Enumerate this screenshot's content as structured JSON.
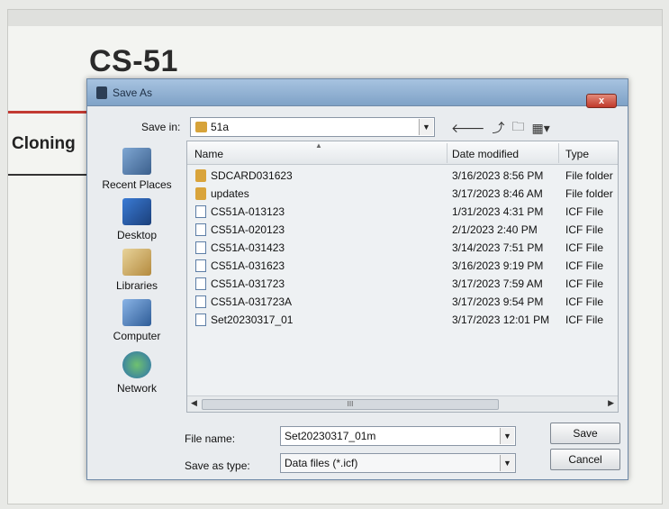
{
  "background": {
    "app_title": "CS-51",
    "side_label": "Cloning"
  },
  "dialog": {
    "title": "Save As",
    "close_label": "x",
    "save_in_label": "Save in:",
    "save_in_value": "51a",
    "places": [
      {
        "label": "Recent Places",
        "icon": "recent-places-icon"
      },
      {
        "label": "Desktop",
        "icon": "desktop-icon"
      },
      {
        "label": "Libraries",
        "icon": "libraries-icon"
      },
      {
        "label": "Computer",
        "icon": "computer-icon"
      },
      {
        "label": "Network",
        "icon": "network-icon"
      }
    ],
    "columns": {
      "name": "Name",
      "date": "Date modified",
      "type": "Type"
    },
    "files": [
      {
        "name": "SDCARD031623",
        "date": "3/16/2023 8:56 PM",
        "type": "File folder",
        "kind": "folder"
      },
      {
        "name": "updates",
        "date": "3/17/2023 8:46 AM",
        "type": "File folder",
        "kind": "folder"
      },
      {
        "name": "CS51A-013123",
        "date": "1/31/2023 4:31 PM",
        "type": "ICF File",
        "kind": "file"
      },
      {
        "name": "CS51A-020123",
        "date": "2/1/2023 2:40 PM",
        "type": "ICF File",
        "kind": "file"
      },
      {
        "name": "CS51A-031423",
        "date": "3/14/2023 7:51 PM",
        "type": "ICF File",
        "kind": "file"
      },
      {
        "name": "CS51A-031623",
        "date": "3/16/2023 9:19 PM",
        "type": "ICF File",
        "kind": "file"
      },
      {
        "name": "CS51A-031723",
        "date": "3/17/2023 7:59 AM",
        "type": "ICF File",
        "kind": "file"
      },
      {
        "name": "CS51A-031723A",
        "date": "3/17/2023 9:54 PM",
        "type": "ICF File",
        "kind": "file"
      },
      {
        "name": "Set20230317_01",
        "date": "3/17/2023 12:01 PM",
        "type": "ICF File",
        "kind": "file"
      }
    ],
    "scroll_grip": "III",
    "file_name_label": "File name:",
    "file_name_value": "Set20230317_01m",
    "save_type_label": "Save as type:",
    "save_type_value": "Data files (*.icf)",
    "save_button": "Save",
    "cancel_button": "Cancel"
  },
  "colors": {
    "titlebar": "#8fb0d3",
    "folder": "#d9a43b",
    "accent_red": "#c23a32"
  }
}
